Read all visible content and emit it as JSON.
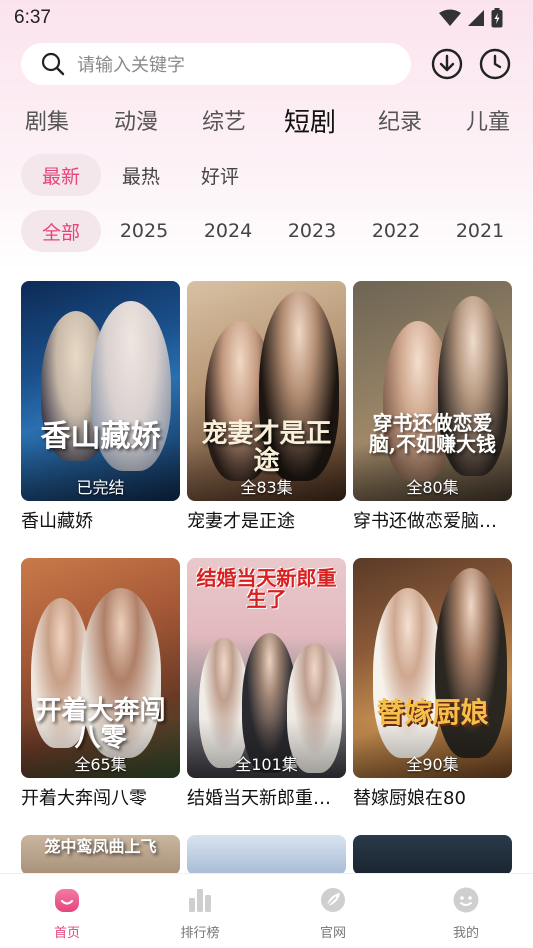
{
  "status_bar": {
    "time": "6:37"
  },
  "search": {
    "placeholder": "请输入关键字"
  },
  "category_tabs": [
    "剧集",
    "动漫",
    "综艺",
    "短剧",
    "纪录",
    "儿童"
  ],
  "active_category": "短剧",
  "sort_filters": [
    "最新",
    "最热",
    "好评"
  ],
  "active_sort": "最新",
  "year_filters": [
    "全部",
    "2025",
    "2024",
    "2023",
    "2022",
    "2021"
  ],
  "active_year": "全部",
  "shows": [
    {
      "title": "香山藏娇",
      "badge": "已完结",
      "poster_text": "香山藏娇"
    },
    {
      "title": "宠妻才是正途",
      "badge": "全83集",
      "poster_text": "宠妻才是正途"
    },
    {
      "title": "穿书还做恋爱脑…",
      "badge": "全80集",
      "poster_text": "穿书还做恋爱脑,不如赚大钱"
    },
    {
      "title": "开着大奔闯八零",
      "badge": "全65集",
      "poster_text": "开着大奔闯八零"
    },
    {
      "title": "结婚当天新郎重…",
      "badge": "全101集",
      "poster_text": "结婚当天新郎重生了"
    },
    {
      "title": "替嫁厨娘在80",
      "badge": "全90集",
      "poster_text": "替嫁厨娘"
    }
  ],
  "partial_row_poster_text": "笼中鸾凤曲上飞",
  "bottom_nav": [
    {
      "label": "首页",
      "icon": "home-icon"
    },
    {
      "label": "排行榜",
      "icon": "bar-chart-icon"
    },
    {
      "label": "官网",
      "icon": "leaf-icon"
    },
    {
      "label": "我的",
      "icon": "face-icon"
    }
  ],
  "active_nav": "首页",
  "colors": {
    "accent": "#e5447c",
    "header_bg": "#fbe3ee",
    "chip_bg": "#f3e7ec"
  }
}
